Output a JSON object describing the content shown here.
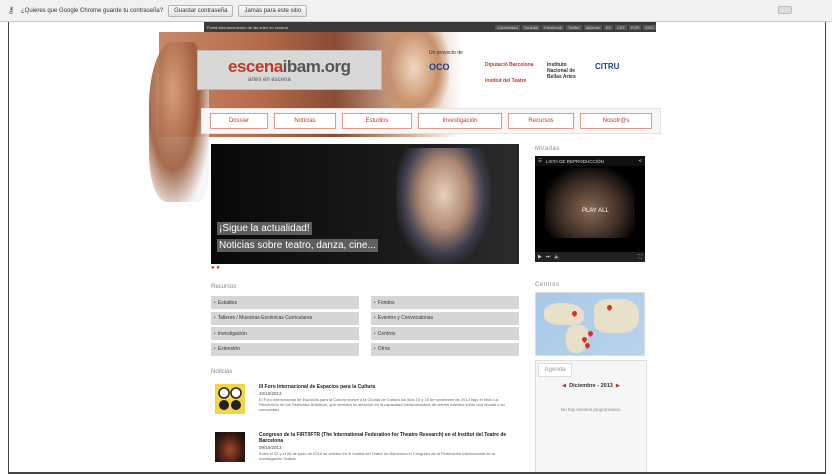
{
  "chrome_prompt": {
    "question": "¿Quieres que Google Chrome guarde tu contraseña?",
    "save_button": "Guardar contraseña",
    "never_button": "Jamás para este sitio"
  },
  "site": {
    "top_strip_title": "Portal Iberoamericano de las artes en escena",
    "top_strip_links": [
      "Comunidad",
      "Youtube",
      "Facebook",
      "Twitter",
      "Idiomas",
      "ES",
      "CAT",
      "POR",
      "ENG"
    ],
    "logo_text_red": "escena",
    "logo_text_grey": "ibam.org",
    "logo_sub": "artes en escena",
    "partners_label": "Un proyecto de",
    "partners": [
      "OCO",
      "Diputació Barcelona",
      "Institut del Teatre",
      "Instituto Nacional de Bellas Artes",
      "CITRU"
    ],
    "nav": [
      "Dossier",
      "Noticias",
      "Estudios",
      "Investigación",
      "Recursos",
      "Nosotr@s"
    ],
    "slider": {
      "caption_1": "¡Sigue la actualidad!",
      "caption_2": "Noticias sobre teatro, danza, cine..."
    },
    "miradas_title": "Miradas",
    "video": {
      "bar_label": "LISTA DE REPRODUCCIÓN",
      "play_label": "PLAY ALL"
    },
    "centros_title": "Centros",
    "agenda": {
      "tab": "Agenda",
      "month": "Diciembre - 2013",
      "empty": "No hay eventos programados."
    },
    "recursos_title": "Recursos",
    "recursos": [
      "Estudios",
      "Fondos",
      "Talleres / Muestras Escénicas Curriculares",
      "Eventos y Convocatorias",
      "Investigación",
      "Centros",
      "Extensión",
      "Otros"
    ],
    "noticias_title": "Noticias",
    "news": [
      {
        "title": "III Foro Internacional de Espacios para la Cultura",
        "date": "10/10/2013",
        "body": "El Foro Internacional de Espacios para la Cultura vuelve a la Ciudad de Cultura los días 15 y 16 de noviembre de 2013 bajo el título La Revolución de los Festivales Artísticos, que centrará su atención en la capacidad transformadora de ciertos eventos sobre una ciudad o su comunidad."
      },
      {
        "title": "Congreso de la FIRT/IFTR (The International Federation for Theatre Research) en el Institut del Teatre de Barcelona",
        "date": "09/10/2013",
        "body": "Entre el 22 y el 26 de junio de 2013 se celebró en el Institut del Teatre de Barcelona el Congreso de la Federación Internacional de la Investigación Teatral."
      }
    ]
  }
}
